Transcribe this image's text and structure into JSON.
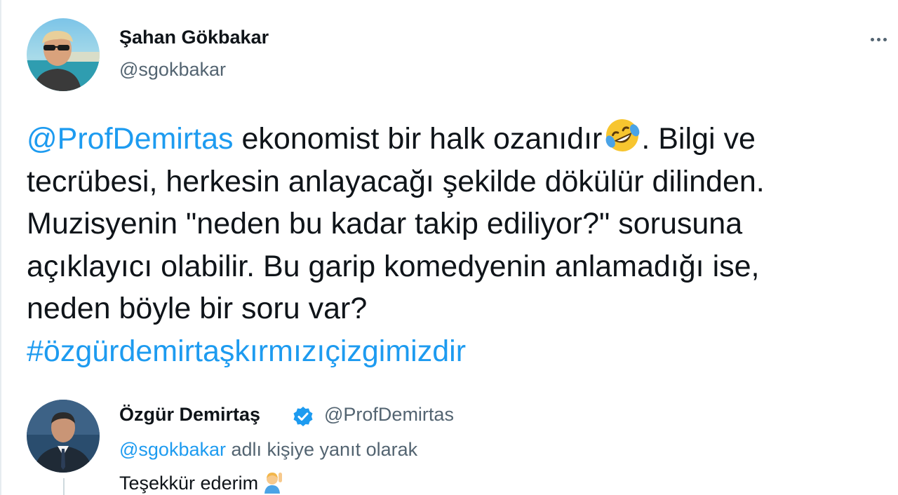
{
  "tweet": {
    "author": {
      "display_name": "Şahan Gökbakar",
      "handle": "@sgokbakar",
      "avatar_icon": "profile-photo"
    },
    "more_menu_icon": "more-dots-icon",
    "body": {
      "mention": "@ProfDemirtas",
      "line1_text": " ekonomist bir halk ozanıdır",
      "line1_emoji": "rolling-on-floor-laughing-emoji",
      "line1_after": ". Bilgi ve",
      "line2": "tecrübesi, herkesin anlayacağı şekilde dökülür dilinden.",
      "line3": "Muzisyenin \"neden bu kadar takip ediliyor?\" sorusuna",
      "line4": "açıklayıcı olabilir. Bu garip komedyenin anlamadığı ise,",
      "line5": "neden böyle bir soru var?",
      "hashtag": "#özgürdemirtaşkırmızıçizgimizdir"
    }
  },
  "quoted_tweet": {
    "author": {
      "display_name": "Özgür Demirtaş",
      "handle": "@ProfDemirtas",
      "verified_icon": "verified-badge-icon",
      "avatar_icon": "profile-photo"
    },
    "reply_context": {
      "mention": "@sgokbakar",
      "text": " adlı kişiye yanıt olarak"
    },
    "text": "Teşekkür ederim",
    "emoji": "person-raising-hand-emoji"
  },
  "colors": {
    "link": "#1d9bf0",
    "secondary_text": "#536471",
    "primary_text": "#0f1419"
  }
}
